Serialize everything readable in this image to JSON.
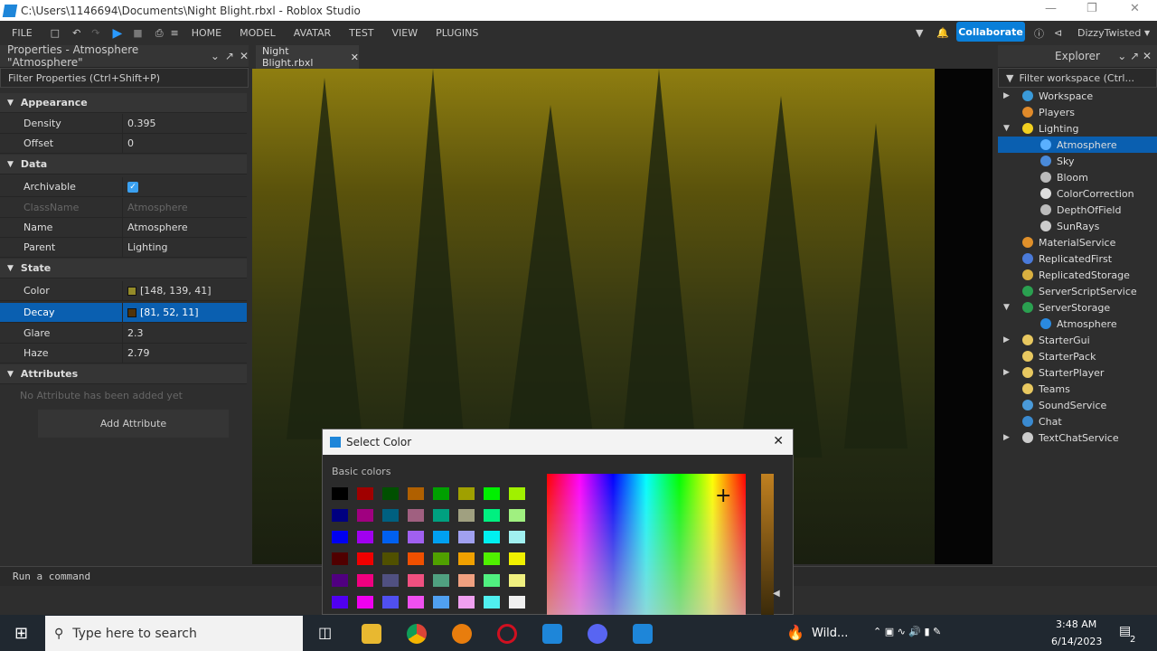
{
  "window": {
    "title": "C:\\Users\\1146694\\Documents\\Night Blight.rbxl - Roblox Studio"
  },
  "menu": {
    "file": "FILE",
    "tabs": [
      "HOME",
      "MODEL",
      "AVATAR",
      "TEST",
      "VIEW",
      "PLUGINS"
    ],
    "collaborate": "Collaborate",
    "user": "DizzyTwisted"
  },
  "properties": {
    "title": "Properties - Atmosphere \"Atmosphere\"",
    "filter": "Filter Properties (Ctrl+Shift+P)",
    "rows": [
      {
        "cat": "Appearance"
      },
      {
        "k": "Density",
        "v": "0.395"
      },
      {
        "k": "Offset",
        "v": "0"
      },
      {
        "cat": "Data"
      },
      {
        "k": "Archivable",
        "check": true
      },
      {
        "k": "ClassName",
        "v": "Atmosphere",
        "dim": true
      },
      {
        "k": "Name",
        "v": "Atmosphere"
      },
      {
        "k": "Parent",
        "v": "Lighting"
      },
      {
        "cat": "State"
      },
      {
        "k": "Color",
        "v": "[148, 139, 41]",
        "color": "#948b29"
      },
      {
        "k": "Decay",
        "v": "[81, 52, 11]",
        "color": "#51340b",
        "sel": true
      },
      {
        "k": "Glare",
        "v": "2.3"
      },
      {
        "k": "Haze",
        "v": "2.79"
      },
      {
        "cat": "Attributes"
      }
    ],
    "no_attr": "No Attribute has been added yet",
    "add_attr": "Add Attribute"
  },
  "viewport": {
    "tab": "Night Blight.rbxl"
  },
  "explorer": {
    "title": "Explorer",
    "filter": "Filter workspace (Ctrl...",
    "items": [
      {
        "l": "Workspace",
        "d": 0,
        "a": "r",
        "c": "#3a9ad9"
      },
      {
        "l": "Players",
        "d": 0,
        "c": "#e08a2a"
      },
      {
        "l": "Lighting",
        "d": 0,
        "a": "d",
        "c": "#f2d020"
      },
      {
        "l": "Atmosphere",
        "d": 1,
        "sel": true,
        "c": "#5ab0ff"
      },
      {
        "l": "Sky",
        "d": 1,
        "c": "#4a8ad9"
      },
      {
        "l": "Bloom",
        "d": 1,
        "c": "#bbb"
      },
      {
        "l": "ColorCorrection",
        "d": 1,
        "c": "#ddd"
      },
      {
        "l": "DepthOfField",
        "d": 1,
        "c": "#bbb"
      },
      {
        "l": "SunRays",
        "d": 1,
        "c": "#ccc"
      },
      {
        "l": "MaterialService",
        "d": 0,
        "c": "#e0902a"
      },
      {
        "l": "ReplicatedFirst",
        "d": 0,
        "c": "#4a7ad9"
      },
      {
        "l": "ReplicatedStorage",
        "d": 0,
        "c": "#d9b040"
      },
      {
        "l": "ServerScriptService",
        "d": 0,
        "c": "#2aa050"
      },
      {
        "l": "ServerStorage",
        "d": 0,
        "a": "d",
        "c": "#2aa050"
      },
      {
        "l": "Atmosphere",
        "d": 1,
        "c": "#2a8ae0"
      },
      {
        "l": "StarterGui",
        "d": 0,
        "a": "r",
        "c": "#e8c860"
      },
      {
        "l": "StarterPack",
        "d": 0,
        "c": "#e8c860"
      },
      {
        "l": "StarterPlayer",
        "d": 0,
        "a": "r",
        "c": "#e8c860"
      },
      {
        "l": "Teams",
        "d": 0,
        "c": "#e8c860"
      },
      {
        "l": "SoundService",
        "d": 0,
        "c": "#4a9ad9"
      },
      {
        "l": "Chat",
        "d": 0,
        "c": "#3a8ad0"
      },
      {
        "l": "TextChatService",
        "d": 0,
        "a": "r",
        "c": "#ccc"
      }
    ]
  },
  "command": {
    "placeholder": "Run a command"
  },
  "dialog": {
    "title": "Select Color",
    "basic": "Basic colors",
    "colors": [
      "#000000",
      "#a00000",
      "#005000",
      "#b06000",
      "#00a000",
      "#a0a000",
      "#00f000",
      "#a0f000",
      "#000080",
      "#a00080",
      "#006080",
      "#a06080",
      "#00a080",
      "#a0a080",
      "#00f080",
      "#a0f080",
      "#0000f0",
      "#a000f0",
      "#0060f0",
      "#a060f0",
      "#00a0f0",
      "#a0a0f0",
      "#00f0f0",
      "#a0f0f0",
      "#500000",
      "#f00000",
      "#505000",
      "#f05000",
      "#50a000",
      "#f0a000",
      "#50f000",
      "#f0f000",
      "#500080",
      "#f00080",
      "#505080",
      "#f05080",
      "#50a080",
      "#f0a080",
      "#50f080",
      "#f0f080",
      "#5000f0",
      "#f000f0",
      "#5050f0",
      "#f050f0",
      "#50a0f0",
      "#f0a0f0",
      "#50f0f0",
      "#f0f0f0"
    ]
  },
  "taskbar": {
    "search": "Type here to search",
    "weather": "Wild...",
    "time": "3:48 AM",
    "date": "6/14/2023",
    "notif": "2"
  }
}
